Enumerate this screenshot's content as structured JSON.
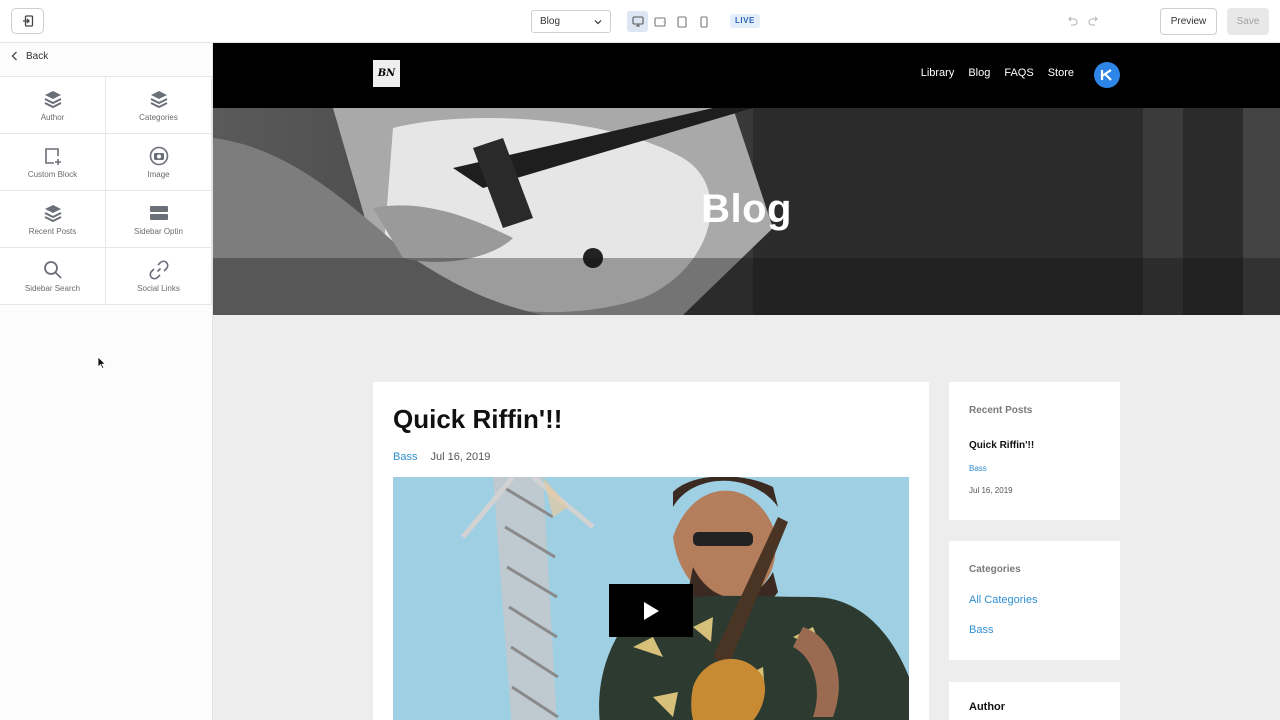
{
  "toolbar": {
    "page_select": "Blog",
    "live_badge": "LIVE",
    "preview_label": "Preview",
    "save_label": "Save",
    "devices": [
      "desktop",
      "tablet-landscape",
      "tablet-portrait",
      "mobile"
    ],
    "active_device": "desktop"
  },
  "panel": {
    "back_label": "Back",
    "tiles": [
      {
        "label": "Author",
        "icon": "layers-icon"
      },
      {
        "label": "Categories",
        "icon": "layers-icon"
      },
      {
        "label": "Custom Block",
        "icon": "add-block-icon"
      },
      {
        "label": "Image",
        "icon": "camera-icon"
      },
      {
        "label": "Recent Posts",
        "icon": "layers-icon"
      },
      {
        "label": "Sidebar Optin",
        "icon": "optin-icon"
      },
      {
        "label": "Sidebar Search",
        "icon": "search-icon"
      },
      {
        "label": "Social Links",
        "icon": "link-icon"
      }
    ]
  },
  "site": {
    "logo": "BN",
    "nav": [
      "Library",
      "Blog",
      "FAQS",
      "Store"
    ],
    "hero_title": "Blog",
    "post": {
      "title": "Quick Riffin'!!",
      "category": "Bass",
      "date": "Jul 16, 2019"
    },
    "recent_posts": {
      "title": "Recent Posts",
      "item_title": "Quick Riffin'!!",
      "item_category": "Bass",
      "item_date": "Jul 16, 2019"
    },
    "categories": {
      "title": "Categories",
      "items": [
        "All Categories",
        "Bass"
      ]
    },
    "author": {
      "title": "Author"
    }
  },
  "colors": {
    "accent": "#2f8fd1",
    "brand_avatar": "#2e85e8",
    "live_bg": "#e4eefb",
    "canvas_bg": "#ededed"
  }
}
